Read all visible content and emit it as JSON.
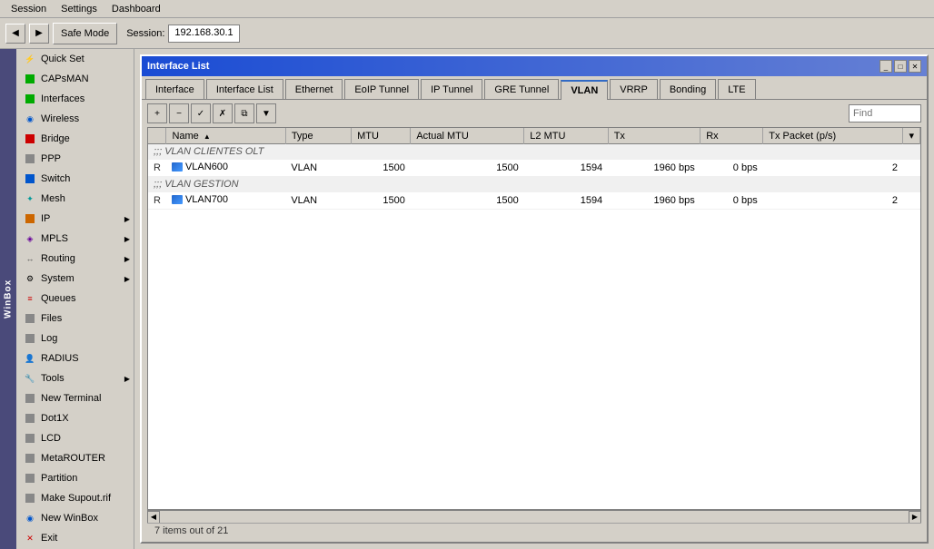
{
  "menubar": {
    "items": [
      "Session",
      "Settings",
      "Dashboard"
    ]
  },
  "toolbar": {
    "back_label": "◀",
    "forward_label": "▶",
    "safe_mode_label": "Safe Mode",
    "session_label": "Session:",
    "session_value": "192.168.30.1"
  },
  "sidebar": {
    "items": [
      {
        "id": "quick-set",
        "label": "Quick Set",
        "icon": "⚡",
        "icon_color": "orange",
        "has_sub": false
      },
      {
        "id": "capsman",
        "label": "CAPsMAN",
        "icon": "■",
        "icon_color": "green",
        "has_sub": false
      },
      {
        "id": "interfaces",
        "label": "Interfaces",
        "icon": "■",
        "icon_color": "green",
        "has_sub": false
      },
      {
        "id": "wireless",
        "label": "Wireless",
        "icon": "◉",
        "icon_color": "blue",
        "has_sub": false
      },
      {
        "id": "bridge",
        "label": "Bridge",
        "icon": "■",
        "icon_color": "red",
        "has_sub": false
      },
      {
        "id": "ppp",
        "label": "PPP",
        "icon": "■",
        "icon_color": "gray",
        "has_sub": false
      },
      {
        "id": "switch",
        "label": "Switch",
        "icon": "⬛",
        "icon_color": "blue",
        "has_sub": false
      },
      {
        "id": "mesh",
        "label": "Mesh",
        "icon": "✦",
        "icon_color": "teal",
        "has_sub": false
      },
      {
        "id": "ip",
        "label": "IP",
        "icon": "■",
        "icon_color": "orange",
        "has_sub": true
      },
      {
        "id": "mpls",
        "label": "MPLS",
        "icon": "◈",
        "icon_color": "purple",
        "has_sub": true
      },
      {
        "id": "routing",
        "label": "Routing",
        "icon": "↔",
        "icon_color": "gray",
        "has_sub": true
      },
      {
        "id": "system",
        "label": "System",
        "icon": "⚙",
        "icon_color": "gray",
        "has_sub": true
      },
      {
        "id": "queues",
        "label": "Queues",
        "icon": "≡",
        "icon_color": "red",
        "has_sub": false
      },
      {
        "id": "files",
        "label": "Files",
        "icon": "📄",
        "icon_color": "gray",
        "has_sub": false
      },
      {
        "id": "log",
        "label": "Log",
        "icon": "📋",
        "icon_color": "gray",
        "has_sub": false
      },
      {
        "id": "radius",
        "label": "RADIUS",
        "icon": "👤",
        "icon_color": "blue",
        "has_sub": false
      },
      {
        "id": "tools",
        "label": "Tools",
        "icon": "🔧",
        "icon_color": "red",
        "has_sub": true
      },
      {
        "id": "new-terminal",
        "label": "New Terminal",
        "icon": "▬",
        "icon_color": "gray",
        "has_sub": false
      },
      {
        "id": "dot1x",
        "label": "Dot1X",
        "icon": "▬",
        "icon_color": "gray",
        "has_sub": false
      },
      {
        "id": "lcd",
        "label": "LCD",
        "icon": "▬",
        "icon_color": "gray",
        "has_sub": false
      },
      {
        "id": "metarouter",
        "label": "MetaROUTER",
        "icon": "▬",
        "icon_color": "gray",
        "has_sub": false
      },
      {
        "id": "partition",
        "label": "Partition",
        "icon": "▬",
        "icon_color": "gray",
        "has_sub": false
      },
      {
        "id": "make-supout",
        "label": "Make Supout.rif",
        "icon": "▬",
        "icon_color": "gray",
        "has_sub": false
      },
      {
        "id": "new-winbox",
        "label": "New WinBox",
        "icon": "◉",
        "icon_color": "blue",
        "has_sub": false
      },
      {
        "id": "exit",
        "label": "Exit",
        "icon": "✕",
        "icon_color": "red",
        "has_sub": false
      }
    ],
    "winbox_label": "WinBox"
  },
  "window": {
    "title": "Interface List",
    "tabs": [
      {
        "id": "interface",
        "label": "Interface",
        "active": false
      },
      {
        "id": "interface-list",
        "label": "Interface List",
        "active": false
      },
      {
        "id": "ethernet",
        "label": "Ethernet",
        "active": false
      },
      {
        "id": "eoip-tunnel",
        "label": "EoIP Tunnel",
        "active": false
      },
      {
        "id": "ip-tunnel",
        "label": "IP Tunnel",
        "active": false
      },
      {
        "id": "gre-tunnel",
        "label": "GRE Tunnel",
        "active": false
      },
      {
        "id": "vlan",
        "label": "VLAN",
        "active": true
      },
      {
        "id": "vrrp",
        "label": "VRRP",
        "active": false
      },
      {
        "id": "bonding",
        "label": "Bonding",
        "active": false
      },
      {
        "id": "lte",
        "label": "LTE",
        "active": false
      }
    ],
    "toolbar_buttons": {
      "add": "+",
      "remove": "−",
      "enable": "✓",
      "disable": "✗",
      "copy": "⧉",
      "filter": "▼"
    },
    "search_placeholder": "Find",
    "table": {
      "columns": [
        {
          "id": "marker",
          "label": ""
        },
        {
          "id": "name",
          "label": "Name",
          "sort": "asc"
        },
        {
          "id": "type",
          "label": "Type"
        },
        {
          "id": "mtu",
          "label": "MTU"
        },
        {
          "id": "actual-mtu",
          "label": "Actual MTU"
        },
        {
          "id": "l2-mtu",
          "label": "L2 MTU"
        },
        {
          "id": "tx",
          "label": "Tx"
        },
        {
          "id": "rx",
          "label": "Rx"
        },
        {
          "id": "tx-packet",
          "label": "Tx Packet (p/s)"
        },
        {
          "id": "more",
          "label": "▾"
        }
      ],
      "groups": [
        {
          "header": ";;; VLAN CLIENTES OLT",
          "rows": [
            {
              "marker": "R",
              "name": "VLAN600",
              "type": "VLAN",
              "mtu": "1500",
              "actual_mtu": "1500",
              "l2_mtu": "1594",
              "tx": "1960 bps",
              "rx": "0 bps",
              "tx_packet": "2"
            }
          ]
        },
        {
          "header": ";;; VLAN GESTION",
          "rows": [
            {
              "marker": "R",
              "name": "VLAN700",
              "type": "VLAN",
              "mtu": "1500",
              "actual_mtu": "1500",
              "l2_mtu": "1594",
              "tx": "1960 bps",
              "rx": "0 bps",
              "tx_packet": "2"
            }
          ]
        }
      ]
    },
    "status": "7 items out of 21"
  }
}
